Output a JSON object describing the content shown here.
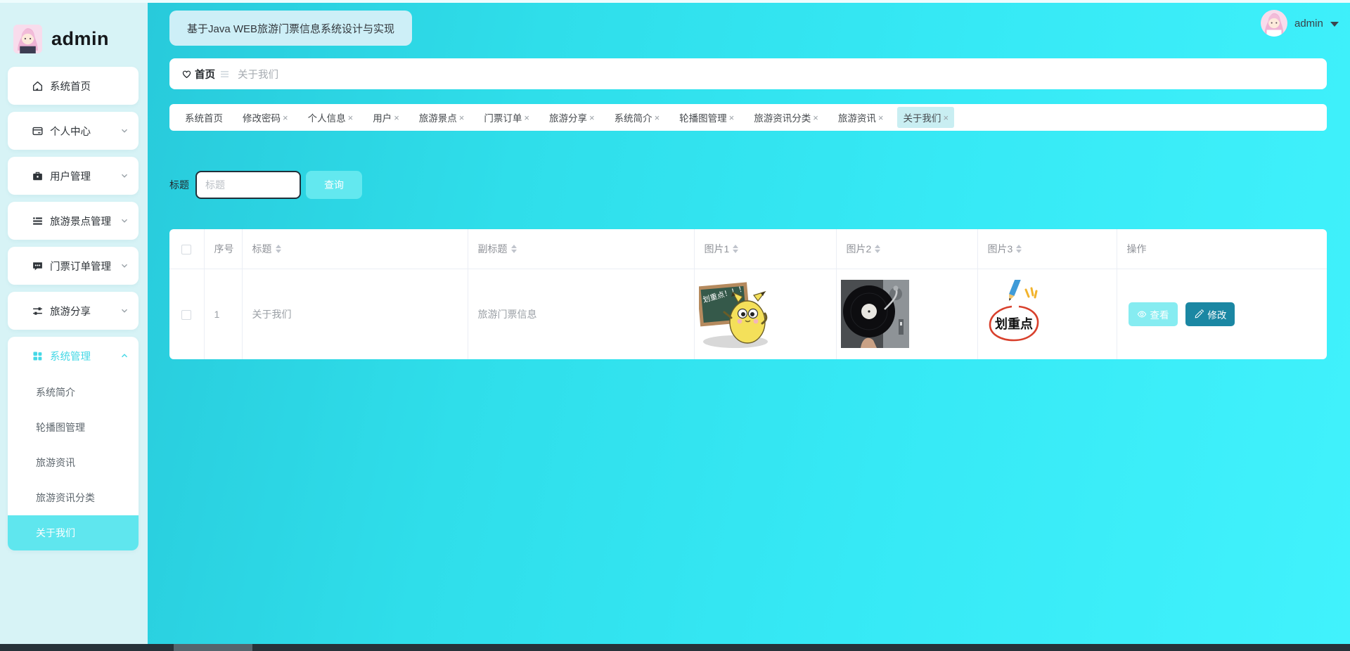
{
  "header": {
    "title_button": "基于Java WEB旅游门票信息系统设计与实现",
    "username": "admin"
  },
  "sidebar": {
    "username": "admin",
    "items": [
      {
        "label": "系统首页",
        "icon": "home-icon",
        "expandable": false
      },
      {
        "label": "个人中心",
        "icon": "card-icon",
        "expandable": true
      },
      {
        "label": "用户管理",
        "icon": "briefcase-icon",
        "expandable": true
      },
      {
        "label": "旅游景点管理",
        "icon": "list-icon",
        "expandable": true
      },
      {
        "label": "门票订单管理",
        "icon": "chat-icon",
        "expandable": true
      },
      {
        "label": "旅游分享",
        "icon": "sliders-icon",
        "expandable": true
      },
      {
        "label": "系统管理",
        "icon": "grid-icon",
        "expandable": true,
        "expanded": true
      }
    ],
    "system_children": [
      {
        "label": "系统简介",
        "active": false
      },
      {
        "label": "轮播图管理",
        "active": false
      },
      {
        "label": "旅游资讯",
        "active": false
      },
      {
        "label": "旅游资讯分类",
        "active": false
      },
      {
        "label": "关于我们",
        "active": true
      }
    ]
  },
  "breadcrumb": {
    "home": "首页",
    "current": "关于我们"
  },
  "tabs": [
    {
      "label": "系统首页",
      "closable": false,
      "active": false
    },
    {
      "label": "修改密码",
      "closable": true,
      "active": false
    },
    {
      "label": "个人信息",
      "closable": true,
      "active": false
    },
    {
      "label": "用户",
      "closable": true,
      "active": false
    },
    {
      "label": "旅游景点",
      "closable": true,
      "active": false
    },
    {
      "label": "门票订单",
      "closable": true,
      "active": false
    },
    {
      "label": "旅游分享",
      "closable": true,
      "active": false
    },
    {
      "label": "系统简介",
      "closable": true,
      "active": false
    },
    {
      "label": "轮播图管理",
      "closable": true,
      "active": false
    },
    {
      "label": "旅游资讯分类",
      "closable": true,
      "active": false
    },
    {
      "label": "旅游资讯",
      "closable": true,
      "active": false
    },
    {
      "label": "关于我们",
      "closable": true,
      "active": true
    }
  ],
  "icons": {
    "tab_close": "×"
  },
  "search": {
    "label": "标题",
    "placeholder": "标题",
    "submit": "查询"
  },
  "table": {
    "columns": [
      "序号",
      "标题",
      "副标题",
      "图片1",
      "图片2",
      "图片3",
      "操作"
    ],
    "rows": [
      {
        "index": "1",
        "title": "关于我们",
        "subtitle": "旅游门票信息",
        "images": [
          {
            "name": "blackboard-pikachu-sticker",
            "text": "划重点！！！"
          },
          {
            "name": "vinyl-record-photo",
            "text": ""
          },
          {
            "name": "highlight-circle-sticker",
            "text": "划重点"
          }
        ],
        "view_label": "查看",
        "edit_label": "修改"
      }
    ]
  },
  "colors": {
    "sidebar_bg": "#d7f3f6",
    "main_gradient_from": "#28cadb",
    "main_gradient_to": "#41f2fc",
    "accent_cyan": "#45d8e6",
    "active_item_bg": "#5fe6ee",
    "title_button_bg": "#cdeff7",
    "active_tab_bg": "#c9eef2",
    "query_button_bg": "#63e8ef",
    "view_button_bg": "#86ecf1",
    "edit_button_bg": "#1b87a3",
    "table_header_text": "#909399",
    "scrollbar_track": "#273239",
    "scrollbar_thumb": "#55656d"
  }
}
